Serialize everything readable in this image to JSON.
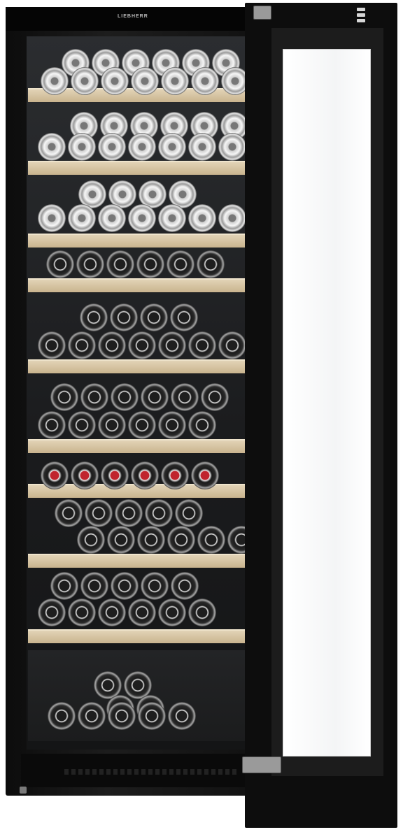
{
  "brand": {
    "logo_text": "LIEBHERR"
  },
  "colors": {
    "cabinet": "#111111",
    "shelf_wood": "#d9c7a4",
    "glass": "#f6f7f8",
    "bottle_foil": "#e8e8e8",
    "red_cap": "#c0242d"
  },
  "icons": [
    "control-panel-icon",
    "hinge-icon"
  ]
}
